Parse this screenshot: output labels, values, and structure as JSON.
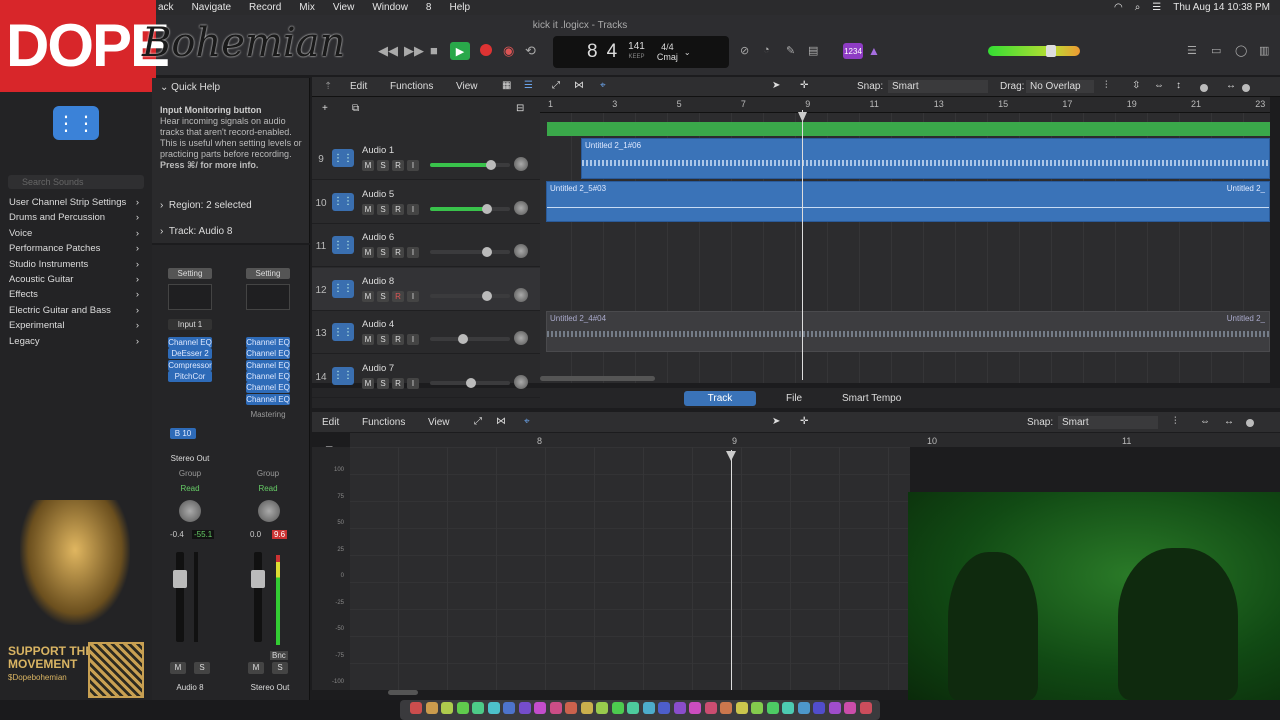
{
  "menubar": {
    "items": [
      "ack",
      "Navigate",
      "Record",
      "Mix",
      "View",
      "Window",
      "8",
      "Help"
    ],
    "clock": "Thu Aug 14  10:38 PM"
  },
  "window": {
    "title": "kick it .logicx - Tracks"
  },
  "logo": {
    "primary": "DOPE",
    "script": "Bohemian"
  },
  "lcd": {
    "bar": "8",
    "beat": "4",
    "bar_label": "BAR",
    "beat_label": "BEAT",
    "tempo": "141",
    "tempo_mode": "KEEP",
    "tempo_label": "TEMPO",
    "signature": "4/4",
    "key": "Cmaj"
  },
  "count_in": "1234",
  "library": {
    "search_placeholder": "Search Sounds",
    "items": [
      "User Channel Strip Settings",
      "Drums and Percussion",
      "Voice",
      "Performance Patches",
      "Studio Instruments",
      "Acoustic Guitar",
      "Effects",
      "Electric Guitar and Bass",
      "Experimental",
      "Legacy"
    ]
  },
  "quick_help": {
    "title": "Quick Help",
    "heading": "Input Monitoring button",
    "body": "Hear incoming signals on audio tracks that aren't record-enabled. This is useful when setting levels or practicing parts before recording.",
    "more": "Press ⌘/ for more info."
  },
  "inspector": {
    "region_label": "Region:",
    "region_value": "2 selected",
    "track_label": "Track:",
    "track_value": "Audio 8"
  },
  "strips": {
    "left": {
      "setting": "Setting",
      "input": "Input 1",
      "plugins": [
        "Channel EQ",
        "DeEsser 2",
        "Compressor",
        "PitchCor"
      ],
      "send": "B 10",
      "output": "Stereo Out",
      "group": "Group",
      "auto": "Read",
      "vol": "-0.4",
      "peak": "-55.1",
      "m": "M",
      "s": "S",
      "name": "Audio 8"
    },
    "right": {
      "setting": "Setting",
      "plugins": [
        "Channel EQ",
        "Channel EQ",
        "Channel EQ",
        "Channel EQ",
        "Channel EQ",
        "Channel EQ"
      ],
      "mastering": "Mastering",
      "group": "Group",
      "auto": "Read",
      "vol": "0.0",
      "peak": "9.6",
      "bnc": "Bnc",
      "m": "M",
      "s": "S",
      "name": "Stereo Out"
    }
  },
  "tracks_header": {
    "edit": "Edit",
    "functions": "Functions",
    "view": "View",
    "snap_label": "Snap:",
    "snap_value": "Smart",
    "drag_label": "Drag:",
    "drag_value": "No Overlap"
  },
  "ruler": [
    "1",
    "3",
    "5",
    "7",
    "9",
    "11",
    "13",
    "15",
    "17",
    "19",
    "21",
    "23"
  ],
  "tracks": [
    {
      "num": "9",
      "name": "Audio 1",
      "vol": 0.75
    },
    {
      "num": "10",
      "name": "Audio 5",
      "vol": 0.7
    },
    {
      "num": "11",
      "name": "Audio 6",
      "vol": 0.7
    },
    {
      "num": "12",
      "name": "Audio 8",
      "vol": 0.7
    },
    {
      "num": "13",
      "name": "Audio 4",
      "vol": 0.4
    },
    {
      "num": "14",
      "name": "Audio 7",
      "vol": 0.5
    }
  ],
  "track_buttons": {
    "m": "M",
    "s": "S",
    "r": "R",
    "i": "I"
  },
  "regions": {
    "r1": "Untitled 2_1#06",
    "r2": "Untitled 2_5#03",
    "r2_end": "Untitled 2_",
    "r3": "Untitled 2_4#04",
    "r3_end": "Untitled 2_"
  },
  "lower": {
    "tabs": [
      "Track",
      "File",
      "Smart Tempo"
    ],
    "edit": "Edit",
    "functions": "Functions",
    "view": "View",
    "snap_label": "Snap:",
    "snap_value": "Smart",
    "ruler": [
      "8",
      "9",
      "10",
      "11"
    ],
    "scale": [
      "100",
      "75",
      "50",
      "25",
      "0",
      "-25",
      "-50",
      "-75",
      "-100"
    ]
  },
  "support": {
    "line1": "SUPPORT THE",
    "line2": "MOVEMENT",
    "handle": "$Dopebohemian"
  }
}
